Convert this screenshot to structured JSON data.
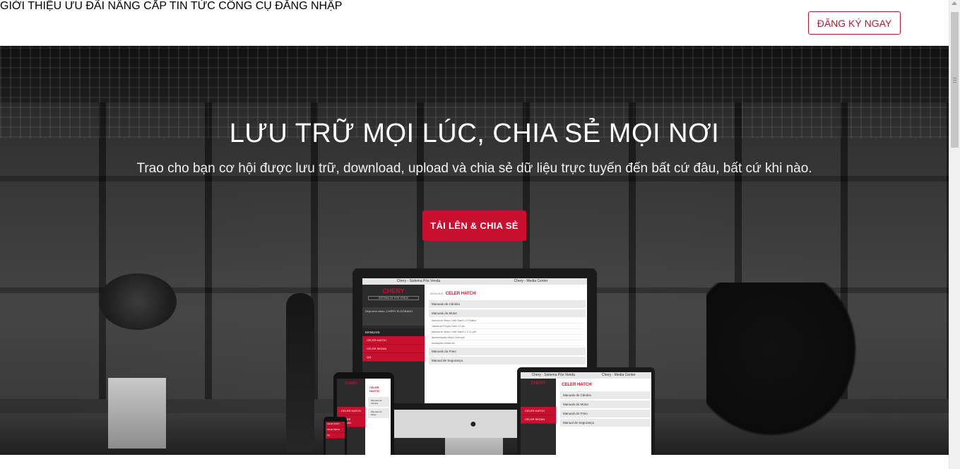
{
  "nav": {
    "items": [
      {
        "label": "GIỚI THIỆU"
      },
      {
        "label": "ƯU ĐÃI"
      },
      {
        "label": "NÂNG CẤP"
      },
      {
        "label": "TIN TỨC"
      },
      {
        "label": "CÔNG CỤ"
      },
      {
        "label": "ĐĂNG NHẬP"
      }
    ],
    "register_label": "ĐĂNG KÝ NGAY"
  },
  "hero": {
    "title": "LƯU TRỮ MỌI LÚC, CHIA SẺ MỌI NƠI",
    "subtitle": "Trao cho bạn cơ hội được lưu trữ, download, upload và chia sẻ dữ liệu trực tuyến đến bất cứ đâu, bất cứ khi nào.",
    "cta_label": "TẢI LÊN & CHIA SẺ"
  },
  "mockup": {
    "tabs": [
      "Chery - Sistema Pós Venda",
      "Chery - Media Center"
    ],
    "logo": "CHERY",
    "logo_tag": "SISTEMA DE PÓS VENDA",
    "user_text": "Seja bem vindo, CHERY ELDORADO",
    "menu_header": "MANUAIS",
    "menu_items": [
      "CELER HATCH",
      "CELER SEDAN",
      "QQ"
    ],
    "breadcrumb": "MANUAIS",
    "breadcrumb_current": "CELER HATCH",
    "sections": [
      "Manuais de Câmbio",
      "Manuais do Motor",
      "Manuais do Freio",
      "Manual de Segurança"
    ],
    "files": [
      "Manual do Motor Celer Hatch 2.0 Edition",
      "Tabela de Preços Celer V2.xls",
      "Manual do Motor Celer Hatch 1.4 V1.pdf",
      "Apresentação Motor Celer.ppt",
      "Anotações Gerais.txt"
    ]
  },
  "colors": {
    "accent": "#c8102e",
    "nav_text": "#333333"
  }
}
